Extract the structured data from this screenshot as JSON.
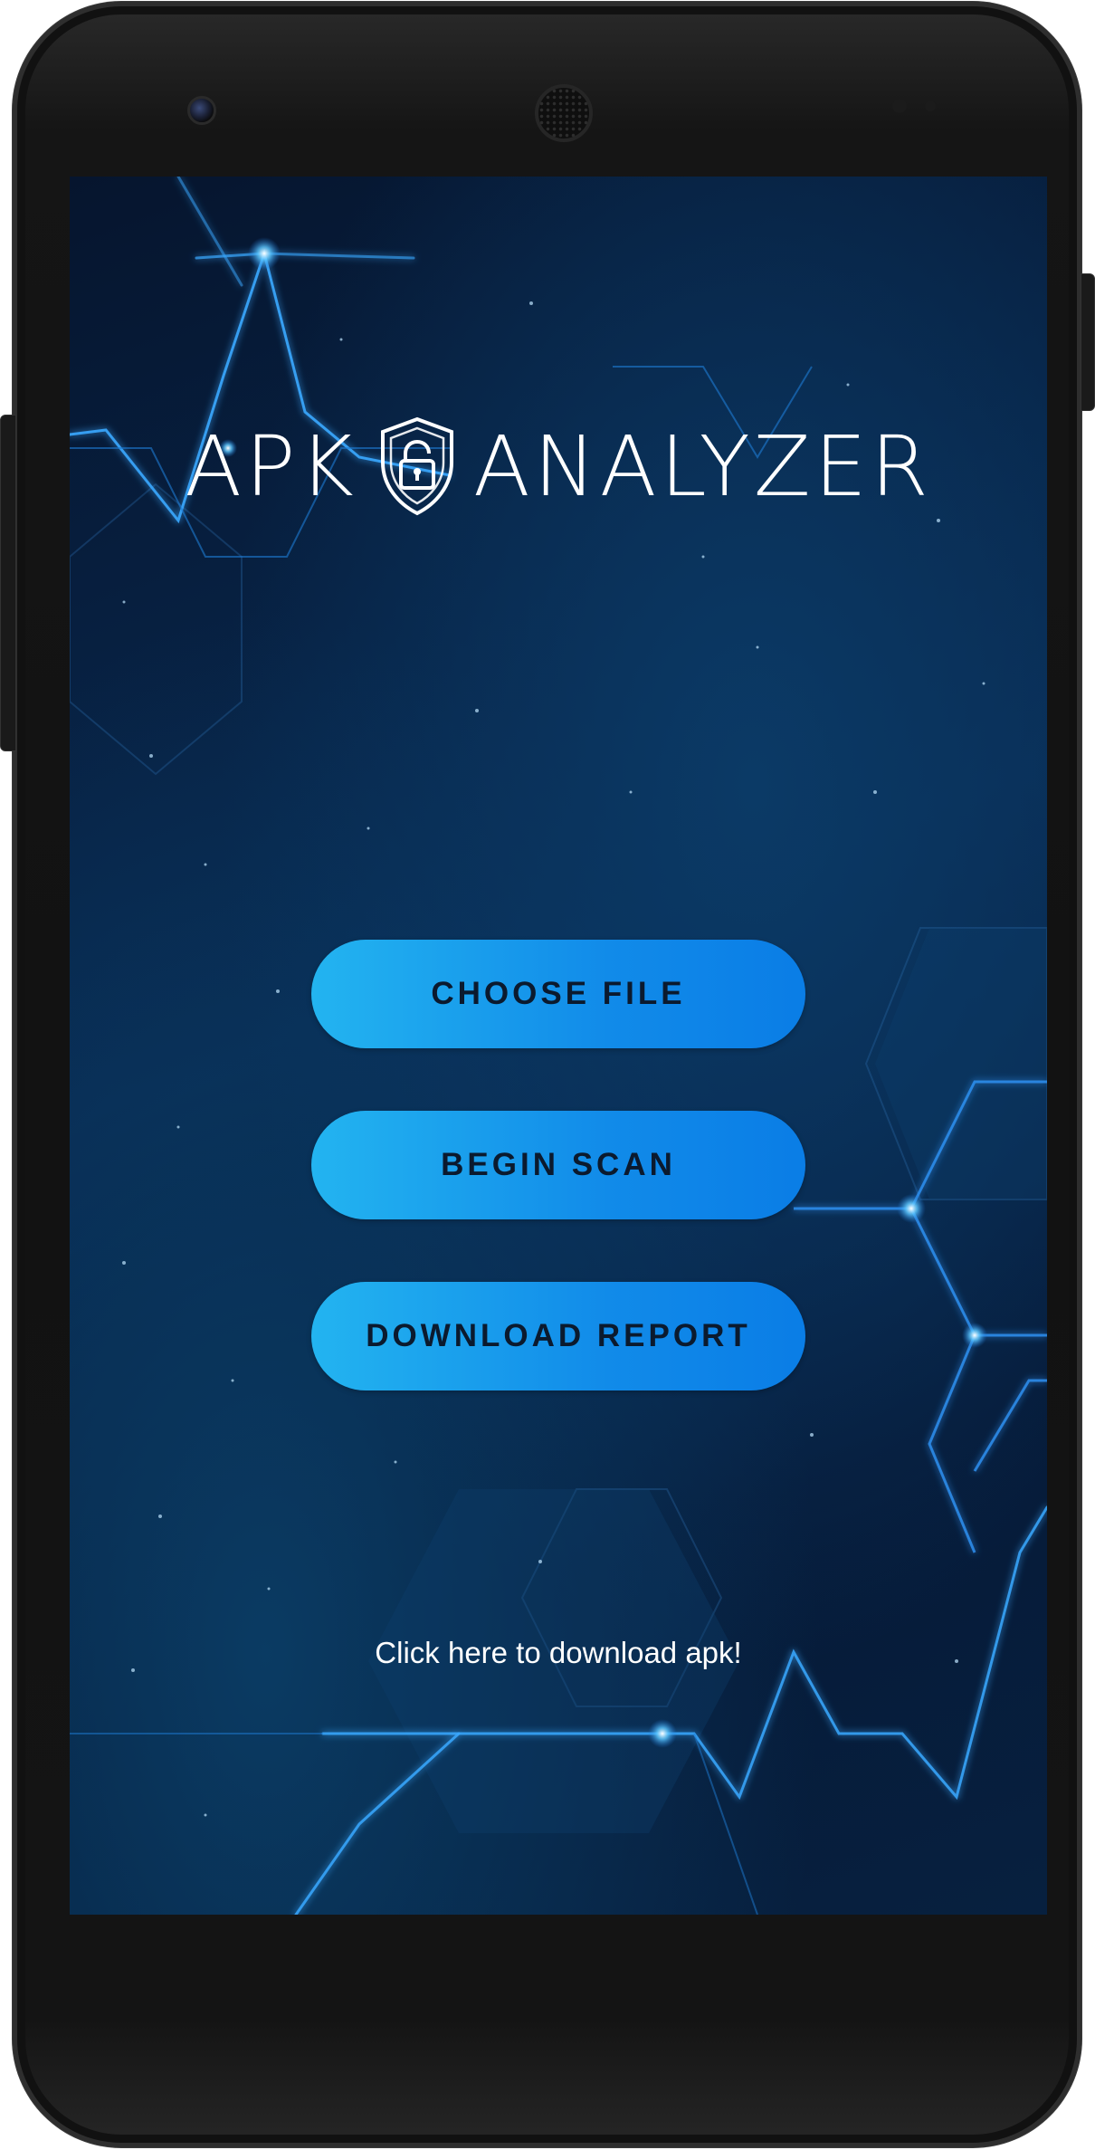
{
  "app": {
    "title_part1": "APK",
    "title_part2": "ANALYZER",
    "logo_icon": "shield-lock-icon"
  },
  "actions": {
    "choose_file": "CHOOSE FILE",
    "begin_scan": "BEGIN SCAN",
    "download_report": "DOWNLOAD REPORT"
  },
  "footer": {
    "download_apk_link": "Click here to download apk!"
  },
  "colors": {
    "button_gradient_start": "#23b4f0",
    "button_gradient_end": "#0a7de6",
    "button_text": "#0b1a2e",
    "screen_background": "#06152e",
    "accent_glow": "#3fb0ff"
  }
}
